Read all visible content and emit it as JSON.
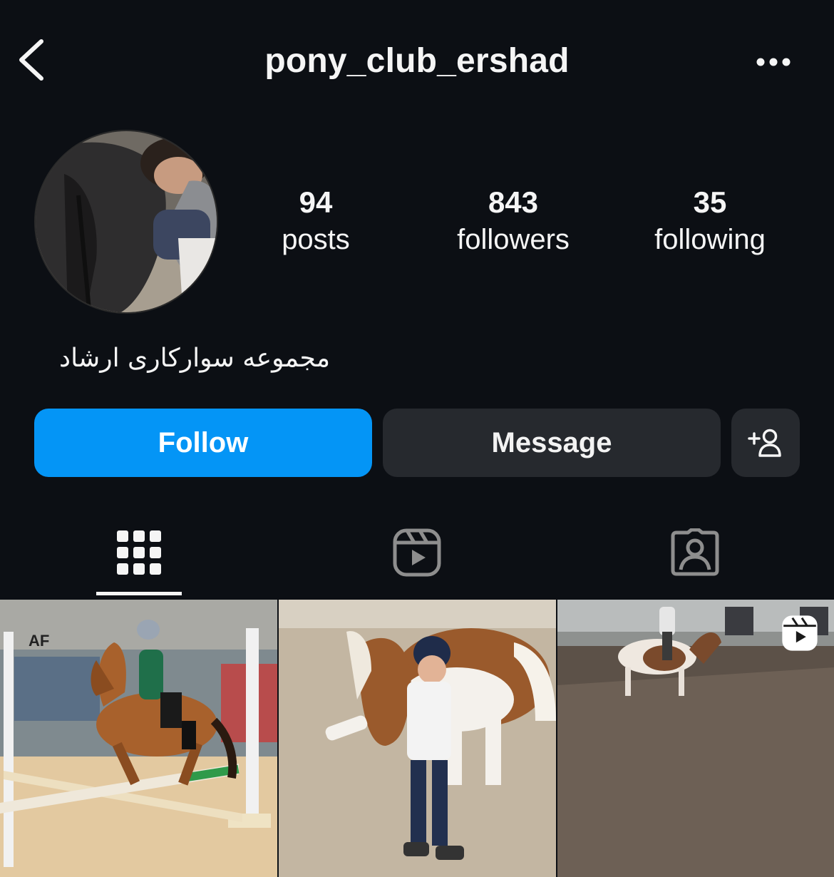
{
  "header": {
    "username": "pony_club_ershad",
    "back_icon": "chevron-left-icon",
    "more_icon": "more-horizontal-icon"
  },
  "profile": {
    "avatar_icon": "avatar-photo",
    "bio": "مجموعه سوارکاری ارشاد",
    "stats": [
      {
        "value": "94",
        "label": "posts"
      },
      {
        "value": "843",
        "label": "followers"
      },
      {
        "value": "35",
        "label": "following"
      }
    ]
  },
  "actions": {
    "follow_label": "Follow",
    "message_label": "Message",
    "add_user_icon": "person-add-icon"
  },
  "tabs": [
    {
      "icon": "grid-icon",
      "active": true
    },
    {
      "icon": "reels-icon",
      "active": false
    },
    {
      "icon": "tagged-icon",
      "active": false
    }
  ],
  "posts": [
    {
      "kind": "photo",
      "subject": "horse-jumping"
    },
    {
      "kind": "photo",
      "subject": "boy-with-pony"
    },
    {
      "kind": "reel",
      "subject": "arena-riding",
      "badge_icon": "reel-badge-icon"
    }
  ],
  "colors": {
    "background": "#0c0f14",
    "follow_button": "#0495f6",
    "secondary_button": "#26292e",
    "text": "#f5f5f5",
    "tab_inactive": "#8e8e8e"
  }
}
